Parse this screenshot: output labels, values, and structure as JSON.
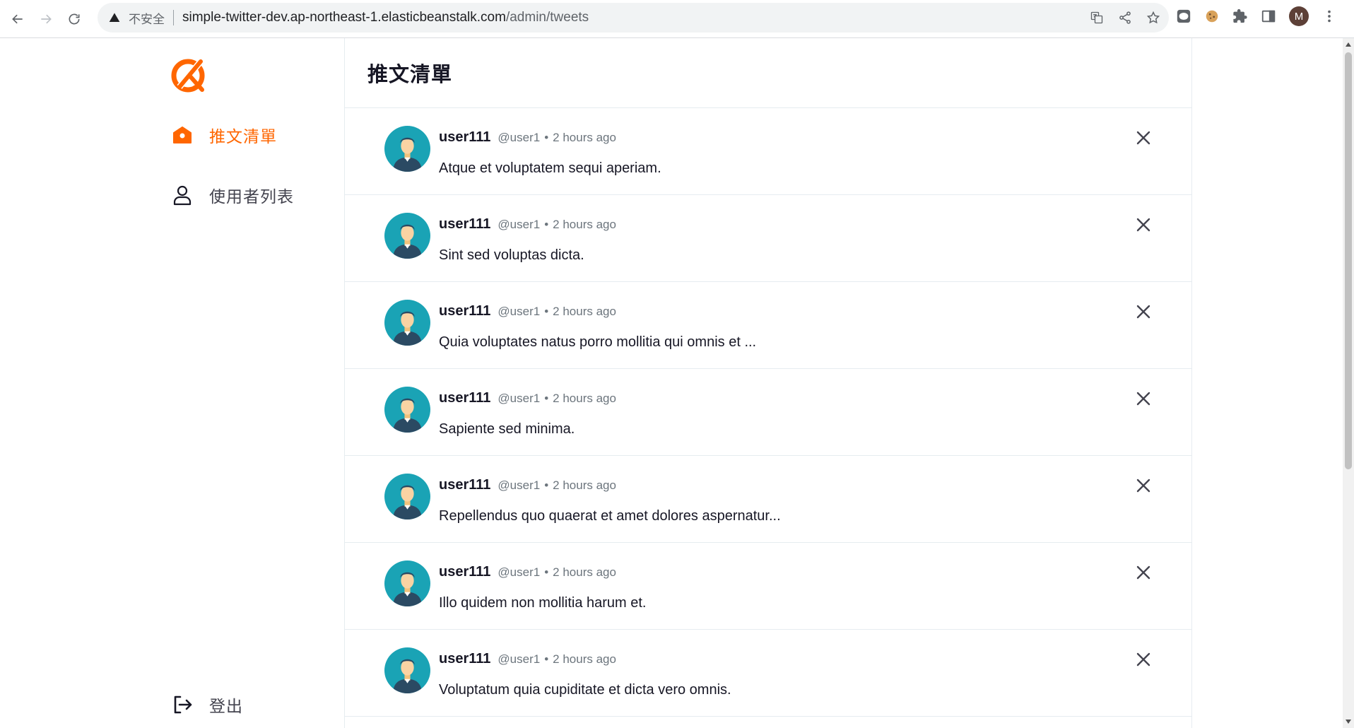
{
  "browser": {
    "insecure_label": "不安全",
    "url_host": "simple-twitter-dev.ap-northeast-1.elasticbeanstalk.com",
    "url_path": "/admin/tweets",
    "profile_initial": "M"
  },
  "sidebar": {
    "logo": "alphacamp-logo",
    "items": [
      {
        "label": "推文清單",
        "icon": "home-icon",
        "active": true
      },
      {
        "label": "使用者列表",
        "icon": "user-icon",
        "active": false
      }
    ],
    "logout_label": "登出"
  },
  "main": {
    "title": "推文清單",
    "tweets": [
      {
        "name": "user111",
        "account": "@user1",
        "time": "2 hours ago",
        "content": "Atque et voluptatem sequi aperiam."
      },
      {
        "name": "user111",
        "account": "@user1",
        "time": "2 hours ago",
        "content": "Sint sed voluptas dicta."
      },
      {
        "name": "user111",
        "account": "@user1",
        "time": "2 hours ago",
        "content": "Quia voluptates natus porro mollitia qui omnis et ..."
      },
      {
        "name": "user111",
        "account": "@user1",
        "time": "2 hours ago",
        "content": "Sapiente sed minima."
      },
      {
        "name": "user111",
        "account": "@user1",
        "time": "2 hours ago",
        "content": "Repellendus quo quaerat et amet dolores aspernatur..."
      },
      {
        "name": "user111",
        "account": "@user1",
        "time": "2 hours ago",
        "content": "Illo quidem non mollitia harum et."
      },
      {
        "name": "user111",
        "account": "@user1",
        "time": "2 hours ago",
        "content": "Voluptatum quia cupiditate et dicta vero omnis."
      }
    ]
  },
  "colors": {
    "brand": "#FF6600",
    "avatar_bg": "#1aa3b5"
  }
}
